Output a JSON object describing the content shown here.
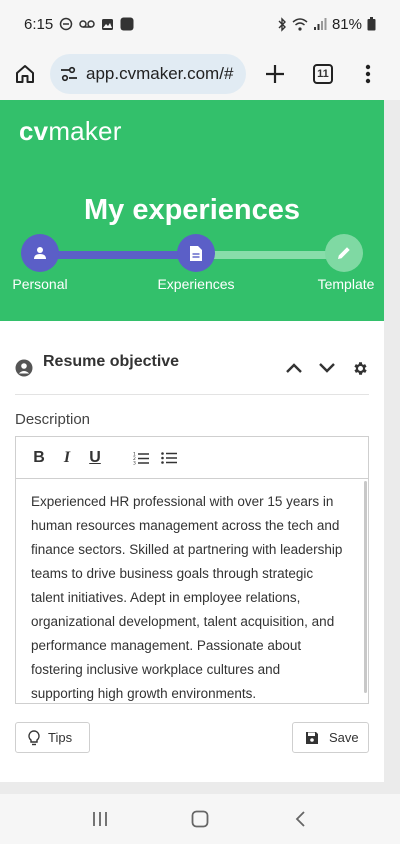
{
  "status_bar": {
    "time": "6:15",
    "battery": "81%"
  },
  "browser": {
    "url": "app.cvmaker.com/#",
    "tab_count": "11"
  },
  "header": {
    "logo_bold": "cv",
    "logo_rest": "maker",
    "title": "My experiences",
    "brand_color": "#33c06b",
    "accent_color": "#5b5fc7"
  },
  "stepper": {
    "steps": [
      {
        "label": "Personal",
        "state": "done",
        "icon": "person-icon"
      },
      {
        "label": "Experiences",
        "state": "current",
        "icon": "document-icon"
      },
      {
        "label": "Template",
        "state": "pending",
        "icon": "pencil-icon"
      }
    ]
  },
  "section": {
    "title": "Resume objective",
    "icon": "account-circle-icon"
  },
  "description": {
    "label": "Description",
    "text": "Experienced HR professional with over 15 years in human resources management across the tech and finance sectors. Skilled at partnering with leadership teams to drive business goals through strategic talent initiatives. Adept in employee relations, organizational development, talent acquisition, and performance management. Passionate about fostering inclusive workplace cultures and supporting high growth environments."
  },
  "toolbar": {
    "bold": "B",
    "italic": "I",
    "underline": "U"
  },
  "actions": {
    "tips_label": "Tips",
    "save_label": "Save"
  }
}
